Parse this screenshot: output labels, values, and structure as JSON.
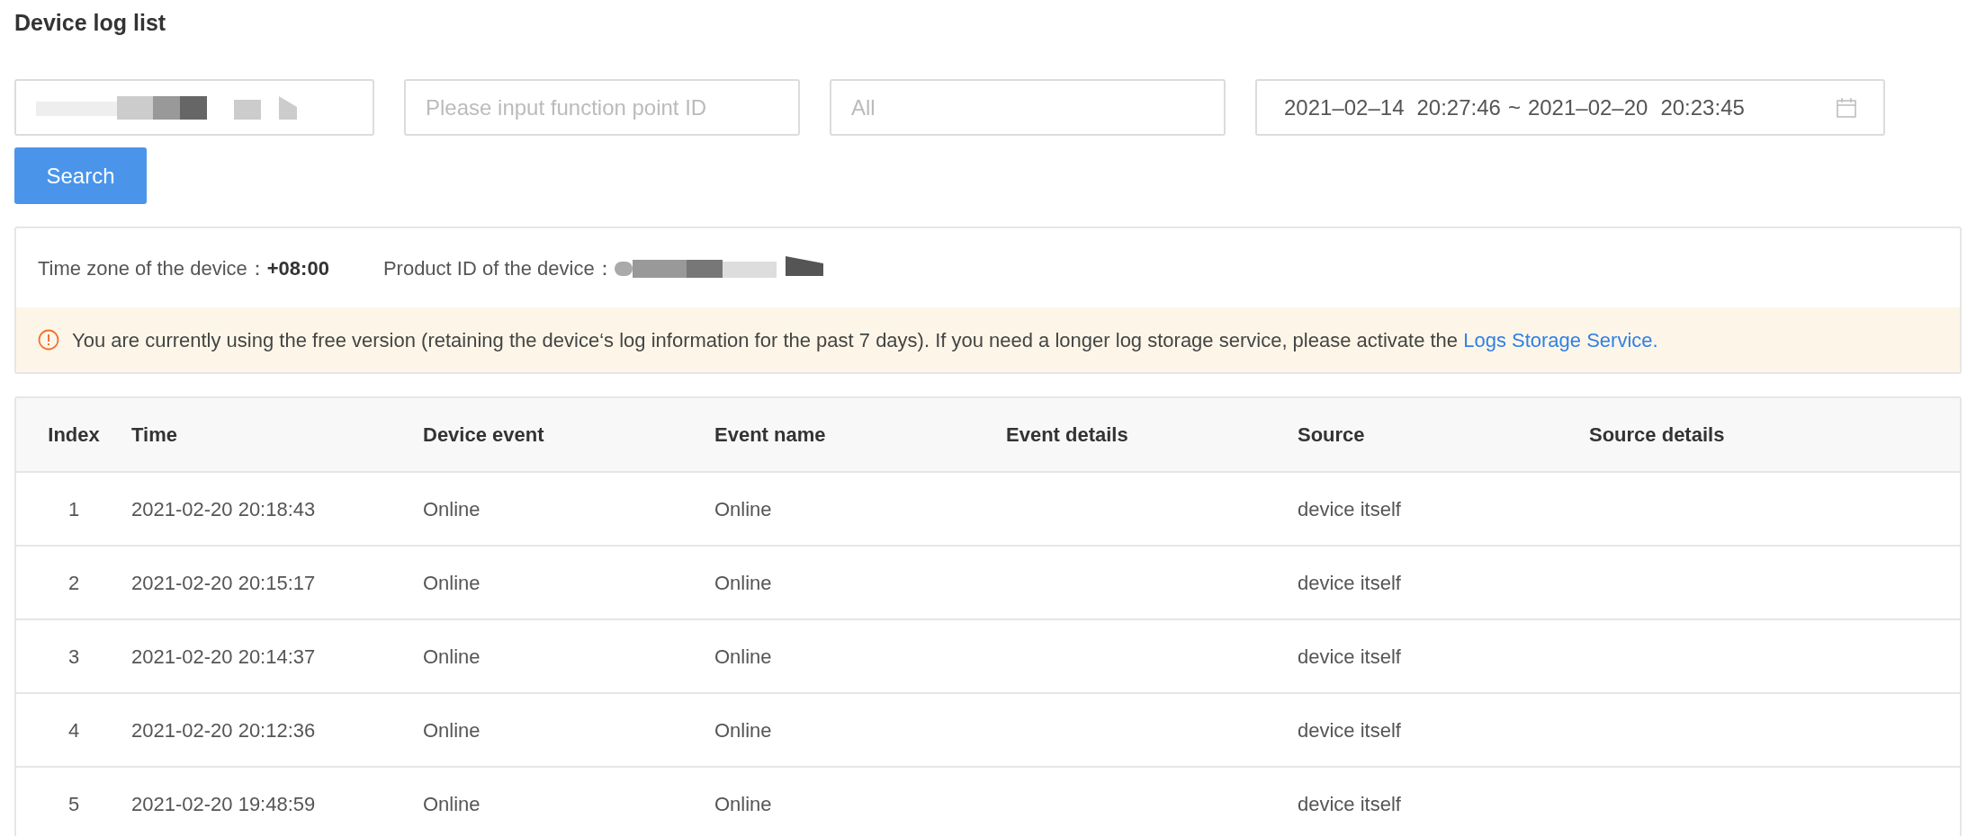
{
  "title": "Device log list",
  "filters": {
    "device_id": {
      "kind": "redacted"
    },
    "function_point": {
      "placeholder": "Please input function point ID"
    },
    "event_type": {
      "placeholder": "All"
    },
    "date_range": {
      "start_date": "2021–02–14",
      "start_time": "20:27:46",
      "separator": "~",
      "end_date": "2021–02–20",
      "end_time": "20:23:45"
    }
  },
  "search_button": "Search",
  "info": {
    "time_zone_label": "Time zone of the device：",
    "time_zone_value": "+08:00",
    "product_id_label": "Product ID of the device：",
    "notice": "You are currently using the free version (retaining the device‘s log information for the past 7 days). If you need a longer log storage service, please activate the",
    "notice_link": "Logs Storage Service."
  },
  "table": {
    "columns": [
      "Index",
      "Time",
      "Device event",
      "Event name",
      "Event details",
      "Source",
      "Source details"
    ],
    "rows": [
      [
        "1",
        "2021-02-20 20:18:43",
        "Online",
        "Online",
        "",
        "device itself",
        ""
      ],
      [
        "2",
        "2021-02-20 20:15:17",
        "Online",
        "Online",
        "",
        "device itself",
        ""
      ],
      [
        "3",
        "2021-02-20 20:14:37",
        "Online",
        "Online",
        "",
        "device itself",
        ""
      ],
      [
        "4",
        "2021-02-20 20:12:36",
        "Online",
        "Online",
        "",
        "device itself",
        ""
      ],
      [
        "5",
        "2021-02-20 19:48:59",
        "Online",
        "Online",
        "",
        "device itself",
        ""
      ]
    ]
  }
}
